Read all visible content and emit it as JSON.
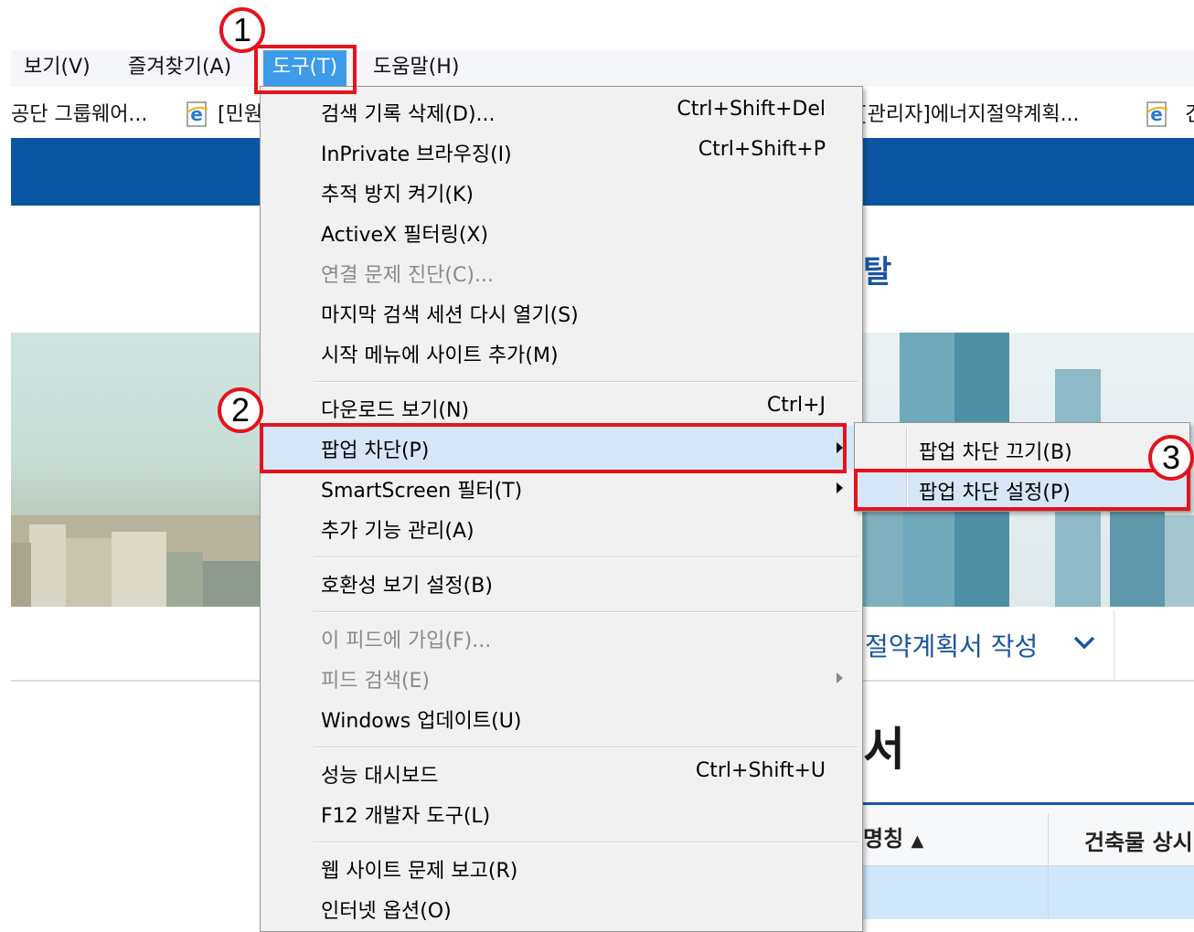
{
  "menubar": {
    "view": "보기(V)",
    "favorites": "즐겨찾기(A)",
    "tools": "도구(T)",
    "help": "도움말(H)"
  },
  "favorites_bar": {
    "item1": "공단 그룹웨어...",
    "item2": "[민원",
    "item3": "[관리자]에너지절약계획...",
    "item4": "건"
  },
  "page": {
    "portal_char": "탈",
    "nav_title": "절약계획서 작성",
    "doc_title": "서",
    "table_col1": "명칭",
    "table_col2": "건축물 상시"
  },
  "tools_menu": {
    "delete_history": "검색 기록 삭제(D)...",
    "delete_history_shortcut": "Ctrl+Shift+Del",
    "inprivate": "InPrivate 브라우징(I)",
    "inprivate_shortcut": "Ctrl+Shift+P",
    "tracking_protection": "추적 방지 켜기(K)",
    "activex_filtering": "ActiveX 필터링(X)",
    "diagnose": "연결 문제 진단(C)...",
    "reopen_session": "마지막 검색 세션 다시 열기(S)",
    "add_to_start": "시작 메뉴에 사이트 추가(M)",
    "view_downloads": "다운로드 보기(N)",
    "view_downloads_shortcut": "Ctrl+J",
    "popup_blocker": "팝업 차단(P)",
    "smartscreen": "SmartScreen 필터(T)",
    "manage_addons": "추가 기능 관리(A)",
    "compat_view": "호환성 보기 설정(B)",
    "subscribe_feed": "이 피드에 가입(F)...",
    "feed_discovery": "피드 검색(E)",
    "windows_update": "Windows 업데이트(U)",
    "performance_dashboard": "성능 대시보드",
    "performance_dashboard_shortcut": "Ctrl+Shift+U",
    "f12_tools": "F12 개발자 도구(L)",
    "report_problem": "웹 사이트 문제 보고(R)",
    "internet_options": "인터넷 옵션(O)"
  },
  "popup_submenu": {
    "turn_off": "팝업 차단 끄기(B)",
    "settings": "팝업 차단 설정(P)"
  },
  "annotations": {
    "step1": "1",
    "step2": "2",
    "step3": "3"
  },
  "colors": {
    "accent_red": "#e6121b",
    "menu_highlight": "#d5e6f7",
    "tools_active": "#3d9be9",
    "header_blue": "#0b56a4"
  }
}
